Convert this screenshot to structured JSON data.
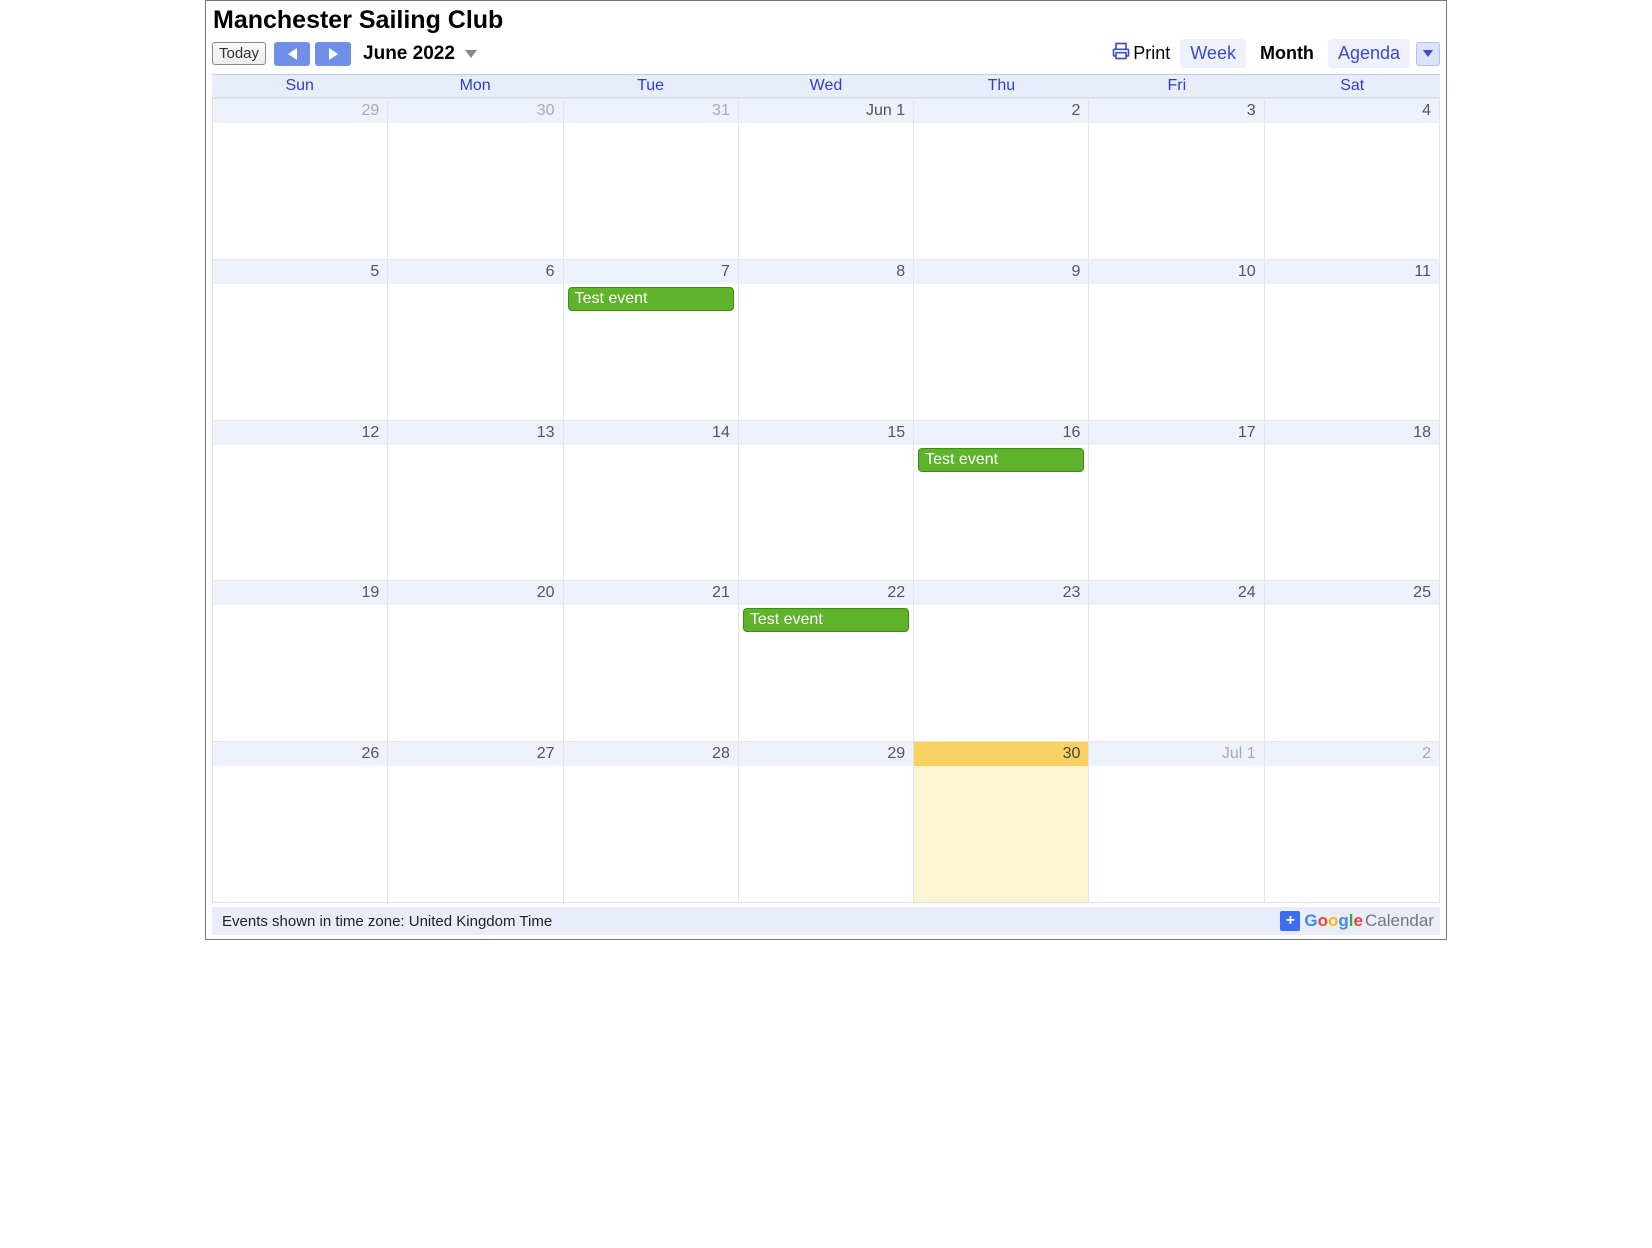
{
  "title": "Manchester Sailing Club",
  "toolbar": {
    "today_label": "Today",
    "month_label": "June 2022",
    "print_label": "Print"
  },
  "views": {
    "week": "Week",
    "month": "Month",
    "agenda": "Agenda",
    "active": "month"
  },
  "day_headers": [
    "Sun",
    "Mon",
    "Tue",
    "Wed",
    "Thu",
    "Fri",
    "Sat"
  ],
  "weeks": [
    [
      {
        "label": "29",
        "other": true
      },
      {
        "label": "30",
        "other": true
      },
      {
        "label": "31",
        "other": true
      },
      {
        "label": "Jun 1"
      },
      {
        "label": "2"
      },
      {
        "label": "3"
      },
      {
        "label": "4"
      }
    ],
    [
      {
        "label": "5"
      },
      {
        "label": "6"
      },
      {
        "label": "7",
        "events": [
          "Test event"
        ]
      },
      {
        "label": "8"
      },
      {
        "label": "9"
      },
      {
        "label": "10"
      },
      {
        "label": "11"
      }
    ],
    [
      {
        "label": "12"
      },
      {
        "label": "13"
      },
      {
        "label": "14"
      },
      {
        "label": "15"
      },
      {
        "label": "16",
        "events": [
          "Test event"
        ]
      },
      {
        "label": "17"
      },
      {
        "label": "18"
      }
    ],
    [
      {
        "label": "19"
      },
      {
        "label": "20"
      },
      {
        "label": "21"
      },
      {
        "label": "22",
        "events": [
          "Test event"
        ]
      },
      {
        "label": "23"
      },
      {
        "label": "24"
      },
      {
        "label": "25"
      }
    ],
    [
      {
        "label": "26"
      },
      {
        "label": "27"
      },
      {
        "label": "28"
      },
      {
        "label": "29"
      },
      {
        "label": "30",
        "today": true
      },
      {
        "label": "Jul 1",
        "other": true
      },
      {
        "label": "2",
        "other": true
      }
    ]
  ],
  "footer": {
    "timezone_text": "Events shown in time zone: United Kingdom Time",
    "gcal_google": "Google",
    "gcal_cal": "Calendar"
  }
}
